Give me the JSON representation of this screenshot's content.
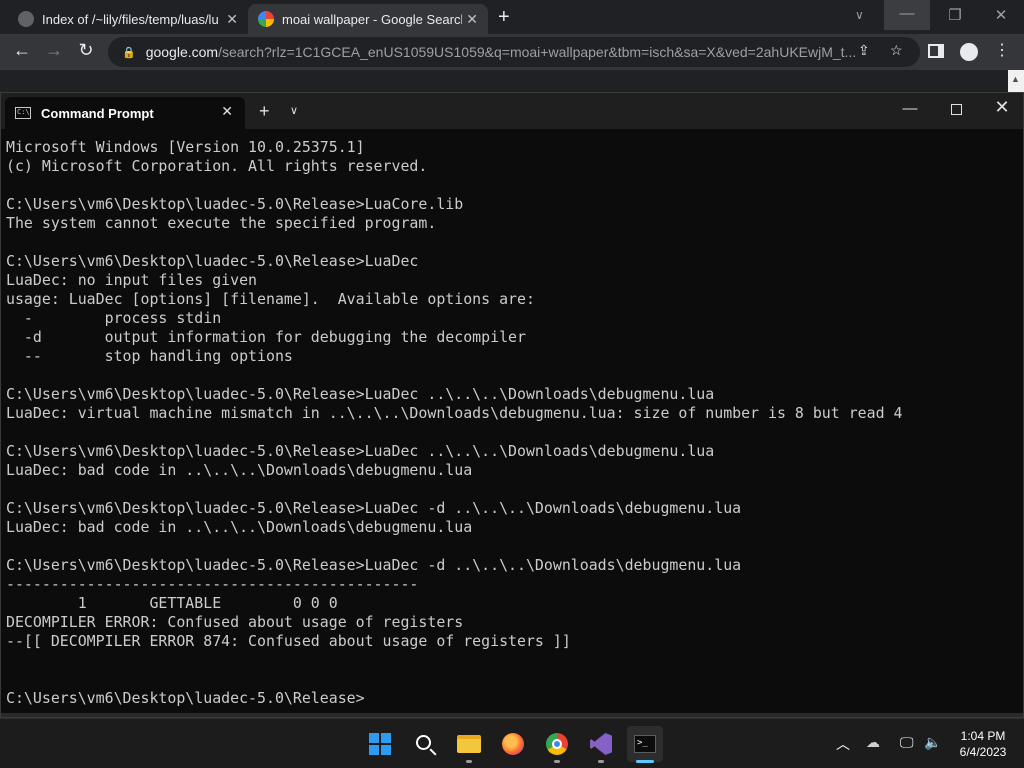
{
  "browser": {
    "tabs": [
      {
        "label": "Index of /~lily/files/temp/luas/lu"
      },
      {
        "label": "moai wallpaper - Google Search"
      }
    ],
    "url_host": "google.com",
    "url_rest": "/search?rlz=1C1GCEA_enUS1059US1059&q=moai+wallpaper&tbm=isch&sa=X&ved=2ahUKEwjM_t..."
  },
  "cmd": {
    "tab_title": "Command Prompt",
    "lines": [
      "Microsoft Windows [Version 10.0.25375.1]",
      "(c) Microsoft Corporation. All rights reserved.",
      "",
      "C:\\Users\\vm6\\Desktop\\luadec-5.0\\Release>LuaCore.lib",
      "The system cannot execute the specified program.",
      "",
      "C:\\Users\\vm6\\Desktop\\luadec-5.0\\Release>LuaDec",
      "LuaDec: no input files given",
      "usage: LuaDec [options] [filename].  Available options are:",
      "  -        process stdin",
      "  -d       output information for debugging the decompiler",
      "  --       stop handling options",
      "",
      "C:\\Users\\vm6\\Desktop\\luadec-5.0\\Release>LuaDec ..\\..\\..\\Downloads\\debugmenu.lua",
      "LuaDec: virtual machine mismatch in ..\\..\\..\\Downloads\\debugmenu.lua: size of number is 8 but read 4",
      "",
      "C:\\Users\\vm6\\Desktop\\luadec-5.0\\Release>LuaDec ..\\..\\..\\Downloads\\debugmenu.lua",
      "LuaDec: bad code in ..\\..\\..\\Downloads\\debugmenu.lua",
      "",
      "C:\\Users\\vm6\\Desktop\\luadec-5.0\\Release>LuaDec -d ..\\..\\..\\Downloads\\debugmenu.lua",
      "LuaDec: bad code in ..\\..\\..\\Downloads\\debugmenu.lua",
      "",
      "C:\\Users\\vm6\\Desktop\\luadec-5.0\\Release>LuaDec -d ..\\..\\..\\Downloads\\debugmenu.lua",
      "----------------------------------------------",
      "        1       GETTABLE        0 0 0",
      "DECOMPILER ERROR: Confused about usage of registers",
      "--[[ DECOMPILER ERROR 874: Confused about usage of registers ]]",
      "",
      "",
      "C:\\Users\\vm6\\Desktop\\luadec-5.0\\Release>"
    ]
  },
  "taskbar": {
    "apps": [
      "start-icon",
      "search-icon",
      "file-explorer-icon",
      "firefox-icon",
      "chrome-icon",
      "visual-studio-icon",
      "terminal-icon"
    ],
    "clock": {
      "time": "1:04 PM",
      "date": "6/4/2023"
    }
  }
}
